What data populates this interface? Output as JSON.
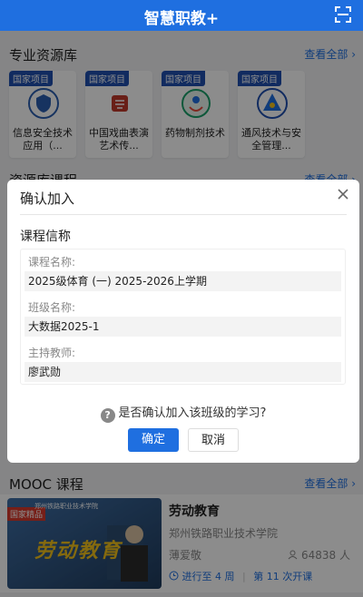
{
  "app": {
    "title": "智慧职教+",
    "scan_icon": "scan-icon"
  },
  "resource_section": {
    "heading": "专业资源库",
    "more": "查看全部 ›",
    "items": [
      {
        "tag": "国家项目",
        "name": "信息安全技术应用（...",
        "icon": "shield-logo"
      },
      {
        "tag": "国家项目",
        "name": "中国戏曲表演艺术传...",
        "icon": "opera-logo"
      },
      {
        "tag": "国家项目",
        "name": "药物制剂技术",
        "icon": "pharmacy-logo"
      },
      {
        "tag": "国家项目",
        "name": "通风技术与安全管理...",
        "icon": "ventilation-logo"
      }
    ]
  },
  "course_section": {
    "heading": "资源库课程",
    "more": "查看全部 ›"
  },
  "dialog": {
    "title": "确认加入",
    "subtitle": "课程信称",
    "fields": [
      {
        "label": "课程名称:",
        "value": "2025级体育 (一) 2025-2026上学期"
      },
      {
        "label": "班级名称:",
        "value": "大数据2025-1"
      },
      {
        "label": "主持教师:",
        "value": "廖武勋"
      }
    ],
    "question": "是否确认加入该班级的学习?",
    "confirm_label": "确定",
    "cancel_label": "取消"
  },
  "mooc_section": {
    "heading": "MOOC 课程",
    "more": "查看全部 ›",
    "card": {
      "tag": "国家精品",
      "banner_school": "郑州铁路职业技术学院",
      "banner_text": "劳动教育",
      "title": "劳动教育",
      "school": "郑州铁路职业技术学院",
      "teacher": "薄爱敬",
      "count": "64838 人",
      "progress": "进行至 4 周",
      "session": "第 11 次开课"
    }
  },
  "colors": {
    "primary": "#1f6fe0",
    "tag_blue": "#1f4fb0",
    "tag_red": "#d83a2c"
  }
}
